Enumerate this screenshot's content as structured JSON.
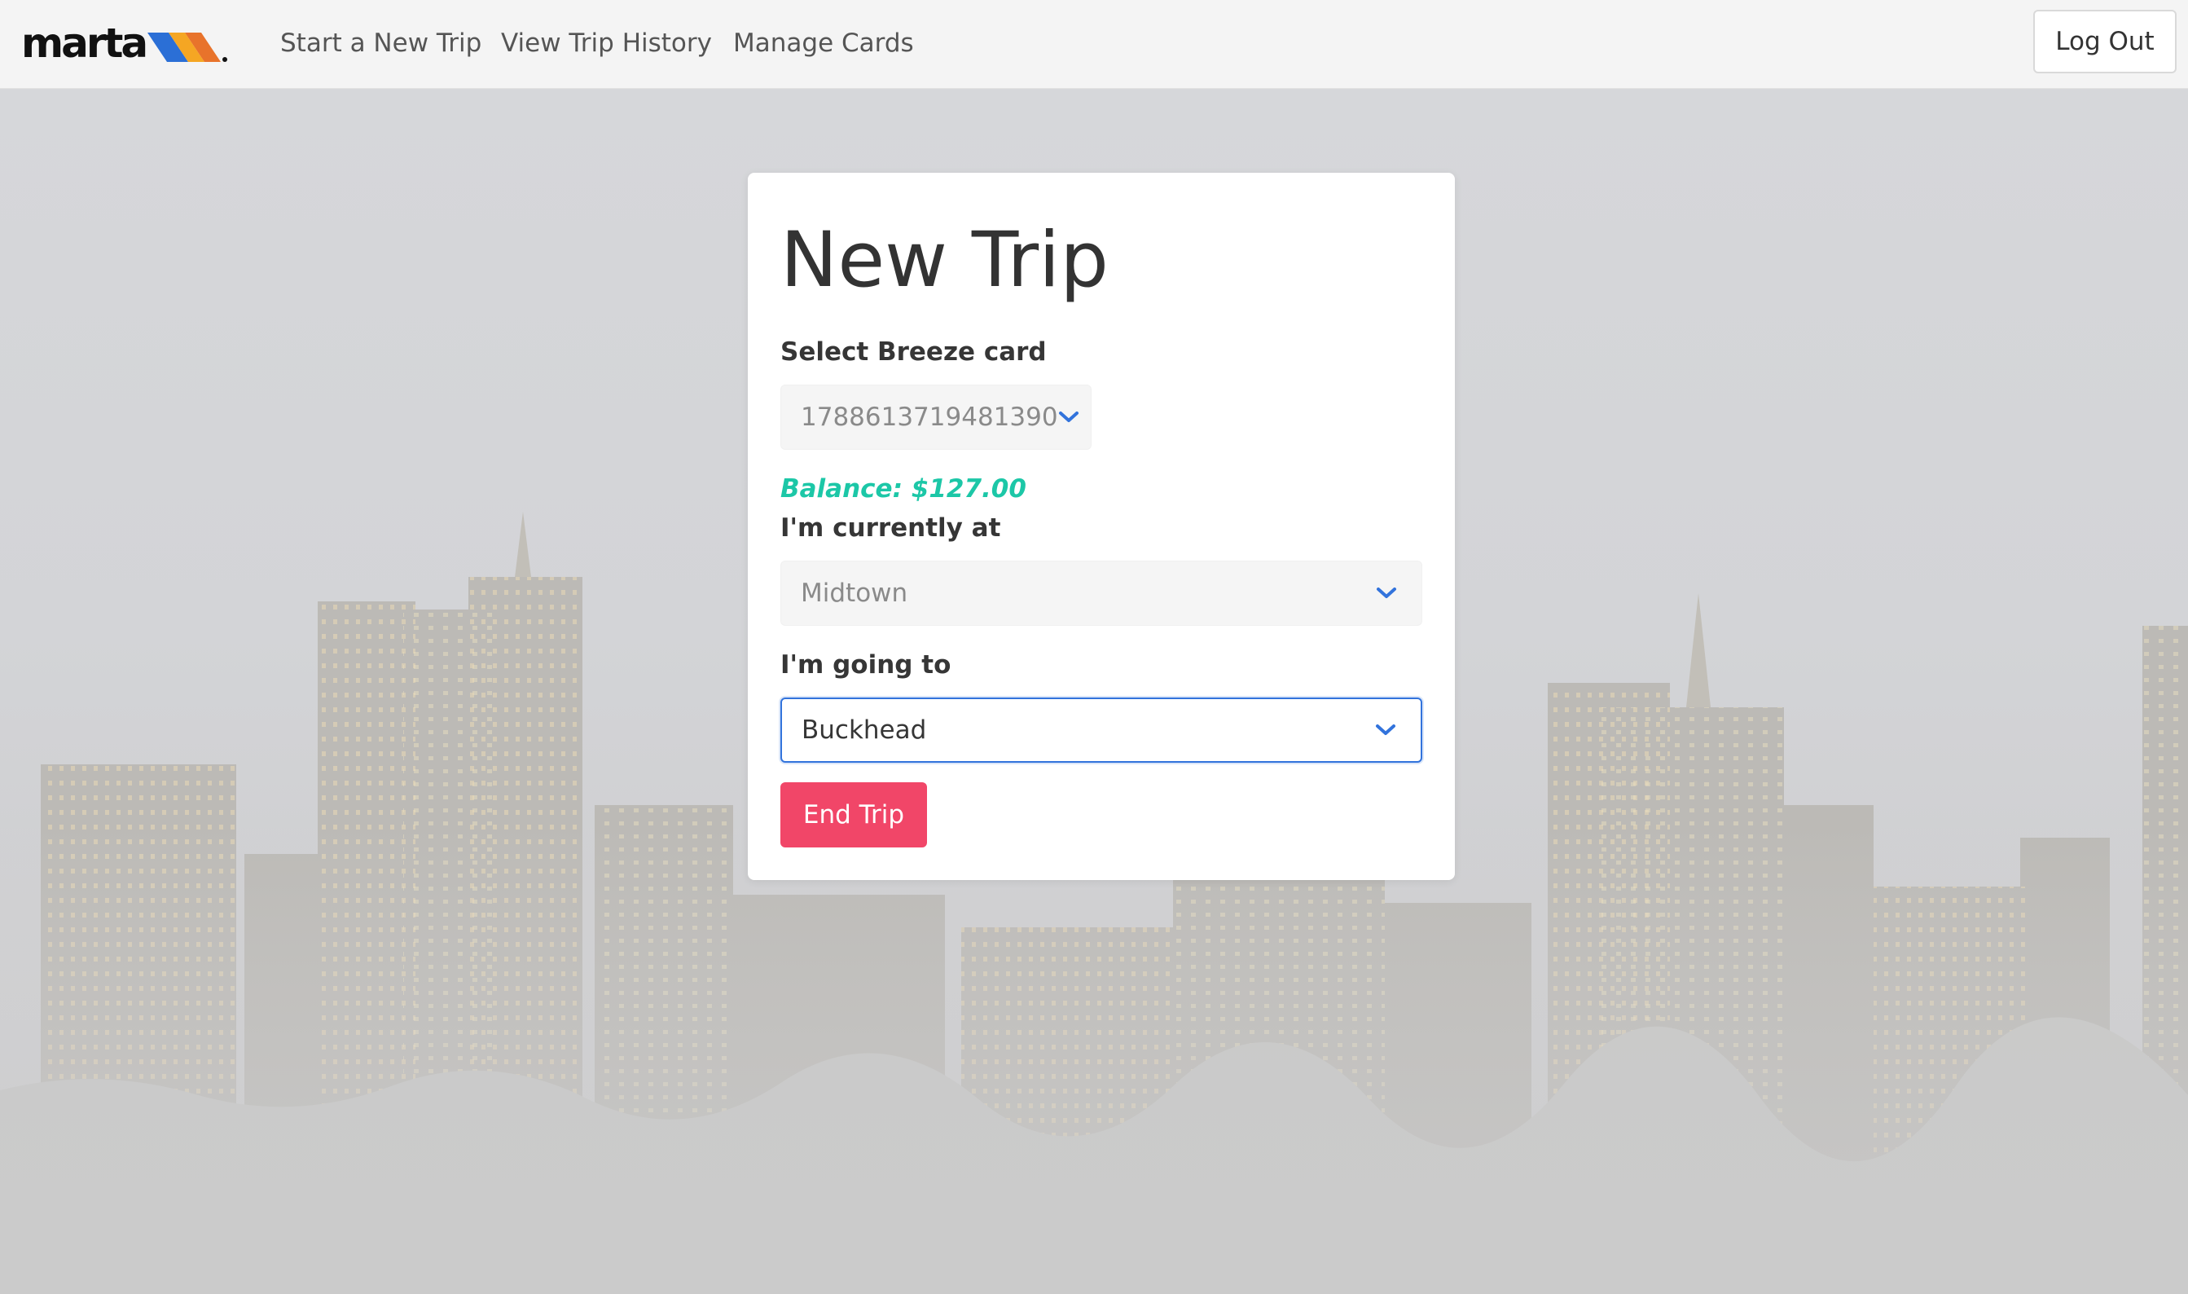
{
  "navbar": {
    "logo_text": "marta",
    "links": [
      {
        "label": "Start a New Trip"
      },
      {
        "label": "View Trip History"
      },
      {
        "label": "Manage Cards"
      }
    ],
    "logout_label": "Log Out"
  },
  "card": {
    "title": "New Trip",
    "select_card_label": "Select Breeze card",
    "selected_card": "1788613719481390",
    "balance": "Balance: $127.00",
    "current_label": "I'm currently at",
    "current_station": "Midtown",
    "destination_label": "I'm going to",
    "destination_station": "Buckhead",
    "end_trip_label": "End Trip"
  },
  "colors": {
    "accent": "#3273dc",
    "balance": "#1cc7a7",
    "danger_button": "#f14668",
    "logo_stripes": [
      "#2b6fd6",
      "#f5a623",
      "#e8732b"
    ]
  },
  "icons": {
    "logo": "marta-logo",
    "select_chevron": "chevron-down-icon"
  }
}
